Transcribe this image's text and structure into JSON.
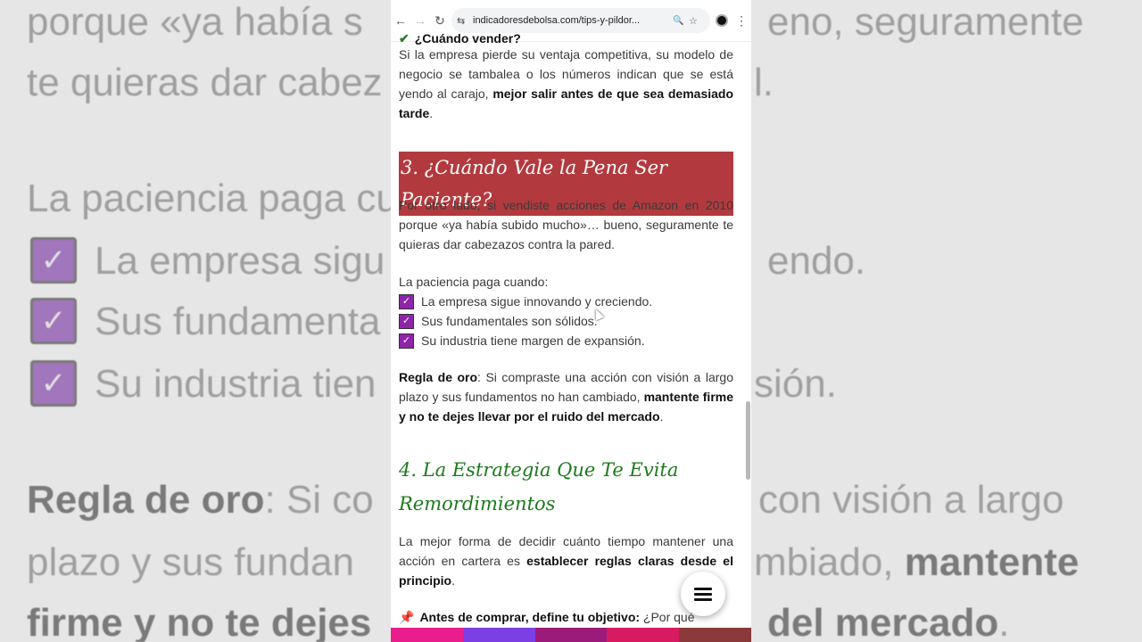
{
  "background": {
    "lines": [
      "porque «ya había s",
      "eno, seguramente",
      "te quieras dar cabez",
      "l.",
      "La paciencia paga cu",
      "La empresa sigu",
      "endo.",
      "Sus fundamenta",
      "Su industria tien",
      "sión.",
      "Regla de oro",
      ": Si co",
      "con visión a largo",
      "plazo y sus fundan",
      "mbiado,",
      "mantente",
      "firme y no te dejes",
      "del mercado",
      "."
    ]
  },
  "browser": {
    "url": "indicadoresdebolsa.com/tips-y-pildor...",
    "back_icon": "←",
    "forward_icon": "→",
    "reload_icon": "↻",
    "site_info_icon": "⇆",
    "zoom_icon": "🔍",
    "star_icon": "☆",
    "menu_icon": "⋮"
  },
  "article": {
    "cut_heading": "¿Cuándo vender?",
    "p1_a": "Si la empresa pierde su ventaja competitiva, su modelo de negocio se tambalea o los números indican que se está yendo al carajo, ",
    "p1_b": "mejor salir antes de que sea demasiado tarde",
    "p1_c": ".",
    "h3": "3. ¿Cuándo Vale la Pena Ser Paciente?",
    "p2": "Por otro lado, si vendiste acciones de Amazon en 2010 porque «ya había subido mucho»… bueno, seguramente te quieras dar cabezazos contra la pared.",
    "list_intro": "La paciencia paga cuando:",
    "list": [
      "La empresa sigue innovando y creciendo.",
      "Sus fundamentales son sólidos.",
      "Su industria tiene margen de expansión."
    ],
    "rule_a": "Regla de oro",
    "rule_b": ": Si compraste una acción con visión a largo plazo y sus fundamentos no han cambiado, ",
    "rule_c": "mantente firme y no te dejes llevar por el ruido del mercado",
    "rule_d": ".",
    "h4": "4. La Estrategia Que Te Evita Remordimientos",
    "p4_a": "La mejor forma de decidir cuánto tiempo mantener una acción en cartera es ",
    "p4_b": "establecer reglas claras desde el principio",
    "p4_c": ".",
    "p5_a": "Antes de comprar, define tu objetivo:",
    "p5_b": " ¿Por qué"
  },
  "colors": {
    "h3_bg": "#b23a3e",
    "h4_text": "#1c7a1c",
    "checkbox": "#8e24aa",
    "share_bar": [
      "#e91e8c",
      "#7b3fe4",
      "#9c1b7a",
      "#d81b60",
      "#8b3a3a"
    ]
  }
}
